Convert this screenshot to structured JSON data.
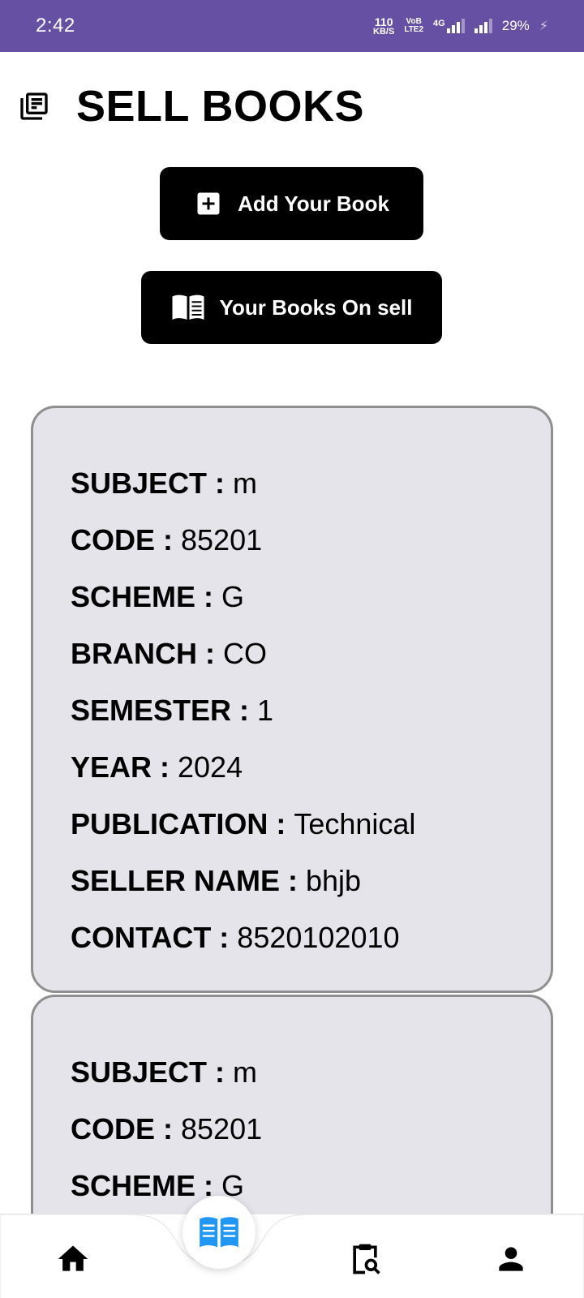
{
  "status_bar": {
    "time": "2:42",
    "net_speed_value": "110",
    "net_speed_unit": "KB/S",
    "volte_top": "VoB",
    "volte_bottom": "LTE2",
    "network_type": "4G",
    "battery": "29%"
  },
  "header": {
    "title": "SELL BOOKS",
    "icon": "library-books-icon"
  },
  "buttons": {
    "add_book": {
      "label": "Add Your Book",
      "icon": "add-box-icon"
    },
    "books_on_sell": {
      "label": "Your Books On sell",
      "icon": "open-book-icon"
    }
  },
  "books": [
    {
      "fields": [
        {
          "label": "SUBJECT : ",
          "value": "m"
        },
        {
          "label": "CODE : ",
          "value": "85201"
        },
        {
          "label": "SCHEME : ",
          "value": "G"
        },
        {
          "label": "BRANCH : ",
          "value": "CO"
        },
        {
          "label": "SEMESTER : ",
          "value": "1"
        },
        {
          "label": "YEAR : ",
          "value": "2024"
        },
        {
          "label": "PUBLICATION : ",
          "value": "Technical"
        },
        {
          "label": "SELLER NAME : ",
          "value": "bhjb"
        },
        {
          "label": "CONTACT : ",
          "value": "8520102010"
        }
      ]
    },
    {
      "fields": [
        {
          "label": "SUBJECT : ",
          "value": "m"
        },
        {
          "label": "CODE : ",
          "value": "85201"
        },
        {
          "label": "SCHEME : ",
          "value": "G"
        }
      ]
    }
  ],
  "bottom_nav": {
    "items": [
      {
        "icon": "home-icon"
      },
      {
        "icon": "book-open-icon",
        "active": true
      },
      {
        "icon": "clipboard-search-icon"
      },
      {
        "icon": "person-icon"
      }
    ],
    "active_color": "#2196f3"
  },
  "colors": {
    "status_bar": "#6650a4",
    "card_background": "#e5e4eb",
    "card_border": "#8f8f8f",
    "button_background": "#000000"
  }
}
